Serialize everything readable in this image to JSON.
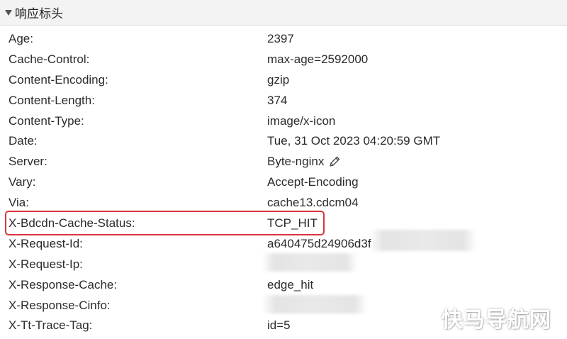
{
  "section": {
    "title": "响应标头",
    "expanded": true
  },
  "headers": [
    {
      "key": "Age:",
      "value": "2397"
    },
    {
      "key": "Cache-Control:",
      "value": "max-age=2592000"
    },
    {
      "key": "Content-Encoding:",
      "value": "gzip"
    },
    {
      "key": "Content-Length:",
      "value": "374"
    },
    {
      "key": "Content-Type:",
      "value": "image/x-icon"
    },
    {
      "key": "Date:",
      "value": "Tue, 31 Oct 2023 04:20:59 GMT"
    },
    {
      "key": "Server:",
      "value": "Byte-nginx"
    },
    {
      "key": "Vary:",
      "value": "Accept-Encoding"
    },
    {
      "key": "Via:",
      "value": "cache13.cdcm04"
    },
    {
      "key": "X-Bdcdn-Cache-Status:",
      "value": "TCP_HIT"
    },
    {
      "key": "X-Request-Id:",
      "value": "a640475d24906d3f"
    },
    {
      "key": "X-Request-Ip:",
      "value": ""
    },
    {
      "key": "X-Response-Cache:",
      "value": "edge_hit"
    },
    {
      "key": "X-Response-Cinfo:",
      "value": ""
    },
    {
      "key": "X-Tt-Trace-Tag:",
      "value": "id=5"
    }
  ],
  "icons": {
    "section_toggle": "triangle-down-icon",
    "server_edit": "pencil-icon"
  },
  "colors": {
    "highlight": "#d9363e",
    "header_bg": "#f3f3f3",
    "text": "#2b2b2b"
  },
  "watermark": "快马导航网"
}
